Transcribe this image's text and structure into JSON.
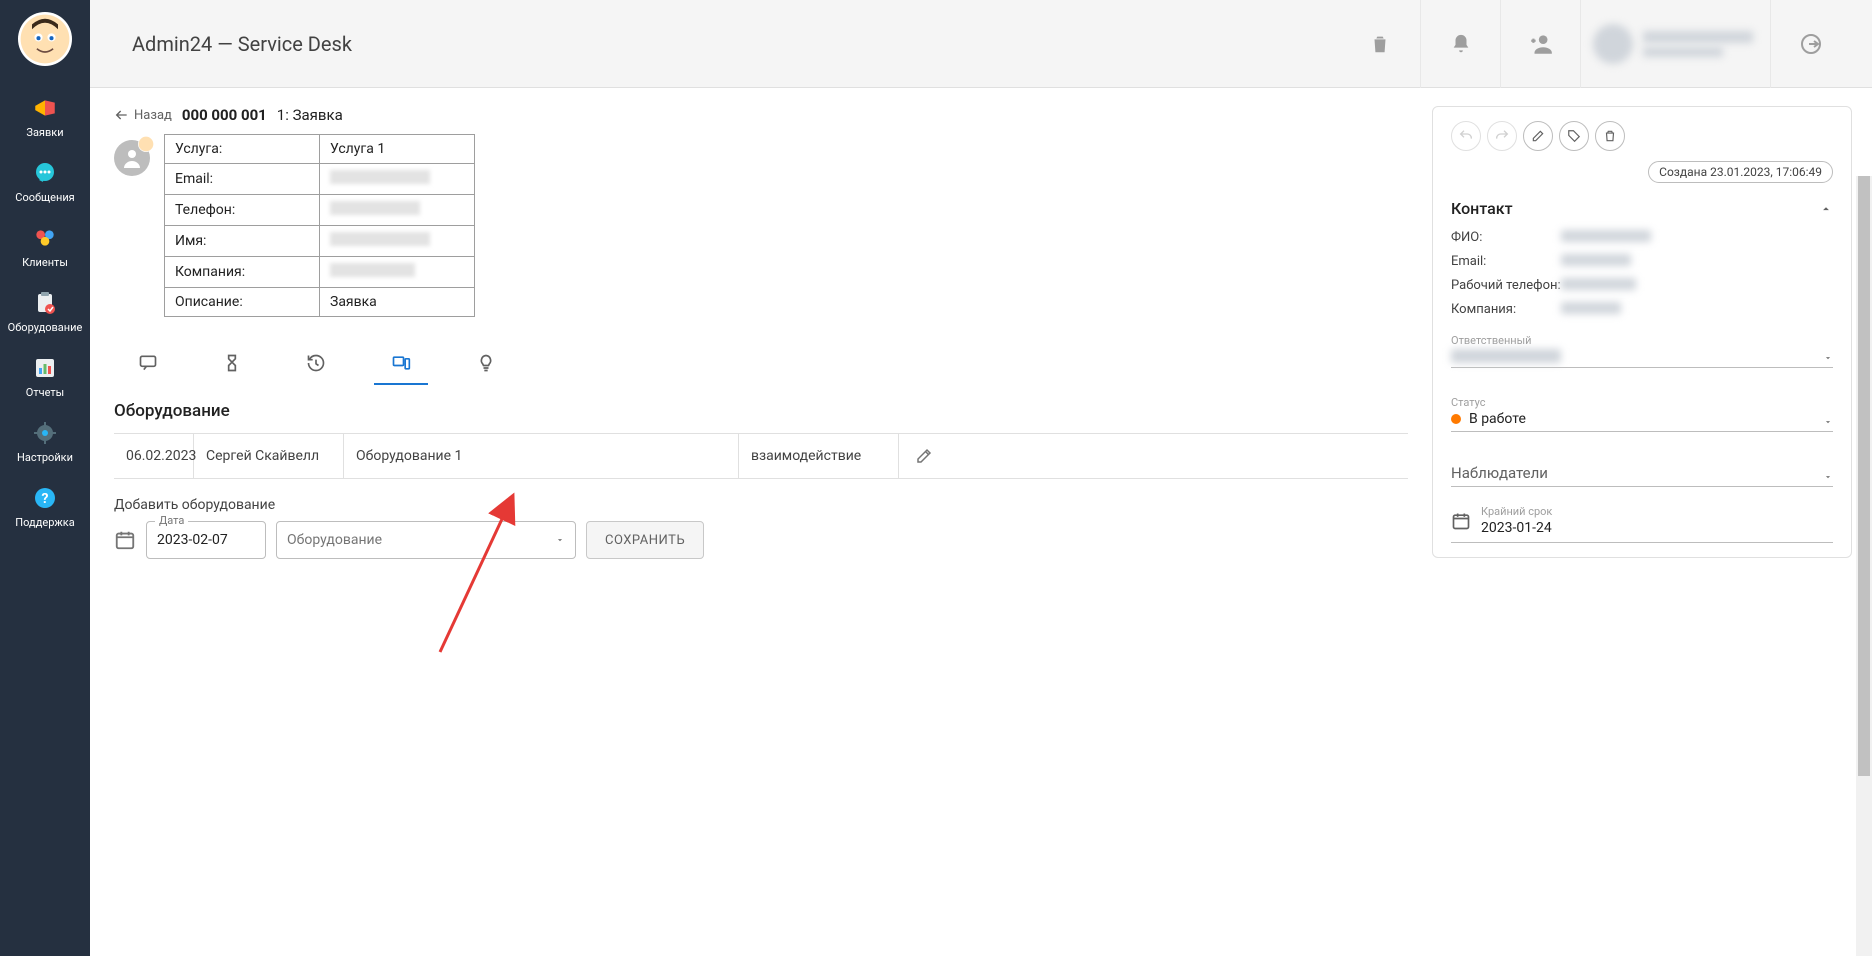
{
  "app_title": "Admin24 — Service Desk",
  "sidebar": {
    "items": [
      {
        "label": "Заявки"
      },
      {
        "label": "Сообщения"
      },
      {
        "label": "Клиенты"
      },
      {
        "label": "Оборудование"
      },
      {
        "label": "Отчеты"
      },
      {
        "label": "Настройки"
      },
      {
        "label": "Поддержка"
      }
    ]
  },
  "back_label": "Назад",
  "ticket_number": "000 000 001",
  "ticket_title": "1: Заявка",
  "info": {
    "service_k": "Услуга:",
    "service_v": "Услуга 1",
    "email_k": "Email:",
    "phone_k": "Телефон:",
    "name_k": "Имя:",
    "company_k": "Компания:",
    "desc_k": "Описание:",
    "desc_v": "Заявка"
  },
  "section_title": "Оборудование",
  "equip_row": {
    "date": "06.02.2023",
    "user": "Сергей Скайвелл",
    "item": "Оборудование 1",
    "action": "взаимодействие"
  },
  "add_label": "Добавить оборудование",
  "date_field_label": "Дата",
  "date_value": "2023-02-07",
  "select_placeholder": "Оборудование",
  "save_label": "СОХРАНИТЬ",
  "created_chip": "Создана 23.01.2023, 17:06:49",
  "contact_title": "Контакт",
  "contact": {
    "fio_k": "ФИО:",
    "email_k": "Email:",
    "phone_k": "Рабочий телефон:",
    "company_k": "Компания:"
  },
  "responsible_label": "Ответственный",
  "status_label": "Статус",
  "status_value": "В работе",
  "watchers_label": "Наблюдатели",
  "deadline_label": "Крайний срок",
  "deadline_value": "2023-01-24"
}
